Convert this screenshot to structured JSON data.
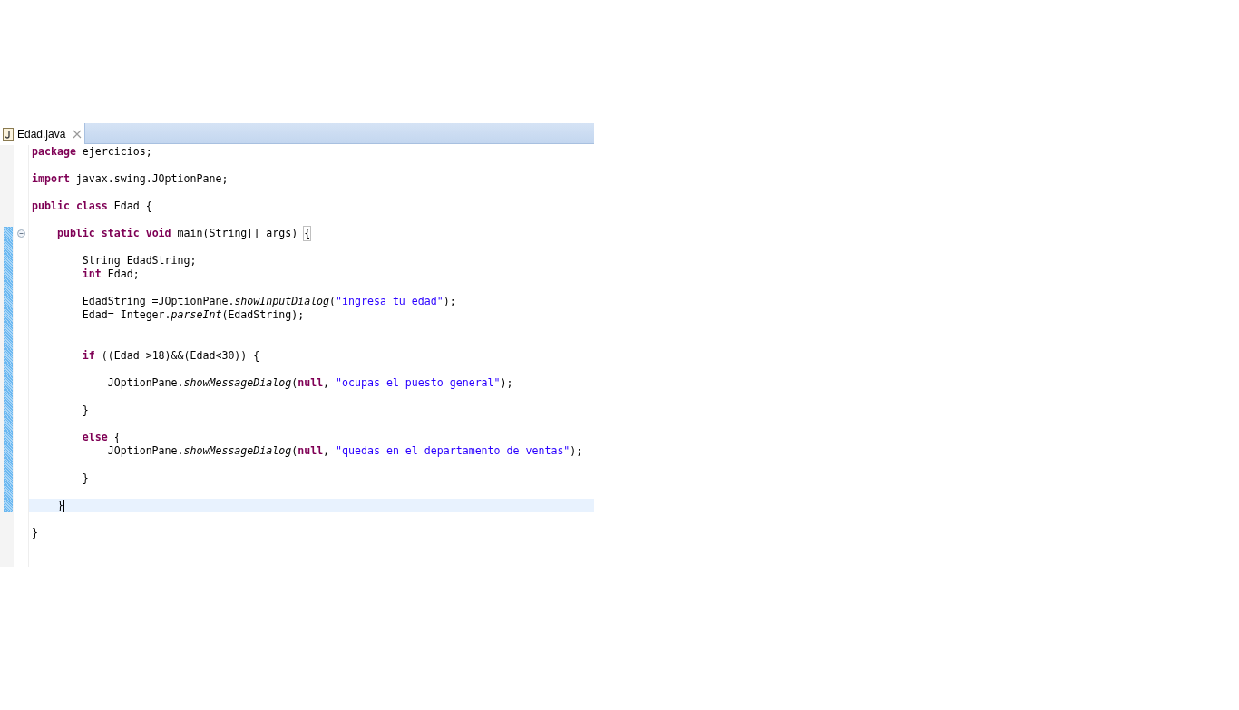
{
  "tab": {
    "title": "Edad.java",
    "selected": true
  },
  "lines": [
    {
      "changed": false,
      "tokens": [
        {
          "kind": "keyword",
          "text": "package"
        },
        {
          "kind": "plain",
          "text": " ejercicios;"
        }
      ]
    },
    {
      "changed": false
    },
    {
      "changed": false,
      "tokens": [
        {
          "kind": "keyword",
          "text": "import"
        },
        {
          "kind": "plain",
          "text": " javax.swing.JOptionPane;"
        }
      ]
    },
    {
      "changed": false
    },
    {
      "changed": false,
      "tokens": [
        {
          "kind": "keyword",
          "text": "public "
        },
        {
          "kind": "keyword",
          "text": "class"
        },
        {
          "kind": "plain",
          "text": " Edad {"
        }
      ]
    },
    {
      "changed": false
    },
    {
      "changed": true,
      "fold_expanded": true,
      "tokens": [
        {
          "kind": "keyword",
          "text": "    public "
        },
        {
          "kind": "keyword",
          "text": "static "
        },
        {
          "kind": "keyword",
          "text": "void"
        },
        {
          "kind": "plain",
          "text": " main(String[] args) "
        },
        {
          "kind": "plain",
          "text": "{",
          "matched": true
        }
      ]
    },
    {
      "changed": true
    },
    {
      "changed": true,
      "tokens": [
        {
          "kind": "plain",
          "text": "        String EdadString;"
        }
      ]
    },
    {
      "changed": true,
      "tokens": [
        {
          "kind": "keyword",
          "text": "        int"
        },
        {
          "kind": "plain",
          "text": " Edad;"
        }
      ]
    },
    {
      "changed": true
    },
    {
      "changed": true,
      "tokens": [
        {
          "kind": "plain",
          "text": "        EdadString =JOptionPane."
        },
        {
          "kind": "method",
          "text": "showInputDialog"
        },
        {
          "kind": "plain",
          "text": "("
        },
        {
          "kind": "string",
          "text": "\"ingresa tu edad\""
        },
        {
          "kind": "plain",
          "text": ");"
        }
      ]
    },
    {
      "changed": true,
      "tokens": [
        {
          "kind": "plain",
          "text": "        Edad= Integer."
        },
        {
          "kind": "method",
          "text": "parseInt"
        },
        {
          "kind": "plain",
          "text": "(EdadString);"
        }
      ]
    },
    {
      "changed": true
    },
    {
      "changed": true
    },
    {
      "changed": true,
      "tokens": [
        {
          "kind": "keyword",
          "text": "        if"
        },
        {
          "kind": "plain",
          "text": " ((Edad >18)&&(Edad<30)) {"
        }
      ]
    },
    {
      "changed": true
    },
    {
      "changed": true,
      "tokens": [
        {
          "kind": "plain",
          "text": "            JOptionPane."
        },
        {
          "kind": "method",
          "text": "showMessageDialog"
        },
        {
          "kind": "plain",
          "text": "("
        },
        {
          "kind": "keyword",
          "text": "null"
        },
        {
          "kind": "plain",
          "text": ", "
        },
        {
          "kind": "string",
          "text": "\"ocupas el puesto general\""
        },
        {
          "kind": "plain",
          "text": ");"
        }
      ]
    },
    {
      "changed": true
    },
    {
      "changed": true,
      "tokens": [
        {
          "kind": "plain",
          "text": "        }"
        }
      ]
    },
    {
      "changed": true
    },
    {
      "changed": true,
      "tokens": [
        {
          "kind": "keyword",
          "text": "        else"
        },
        {
          "kind": "plain",
          "text": " {"
        }
      ]
    },
    {
      "changed": true,
      "tokens": [
        {
          "kind": "plain",
          "text": "            JOptionPane."
        },
        {
          "kind": "method",
          "text": "showMessageDialog"
        },
        {
          "kind": "plain",
          "text": "("
        },
        {
          "kind": "keyword",
          "text": "null"
        },
        {
          "kind": "plain",
          "text": ", "
        },
        {
          "kind": "string",
          "text": "\"quedas en el departamento de ventas\""
        },
        {
          "kind": "plain",
          "text": ");"
        }
      ]
    },
    {
      "changed": true
    },
    {
      "changed": true,
      "tokens": [
        {
          "kind": "plain",
          "text": "        }"
        }
      ]
    },
    {
      "changed": true
    },
    {
      "changed": true,
      "current": true,
      "tokens": [
        {
          "kind": "plain",
          "text": "    }"
        }
      ]
    },
    {
      "changed": false
    },
    {
      "changed": false,
      "tokens": [
        {
          "kind": "plain",
          "text": "}"
        }
      ]
    },
    {
      "changed": false
    },
    {
      "changed": false
    }
  ]
}
